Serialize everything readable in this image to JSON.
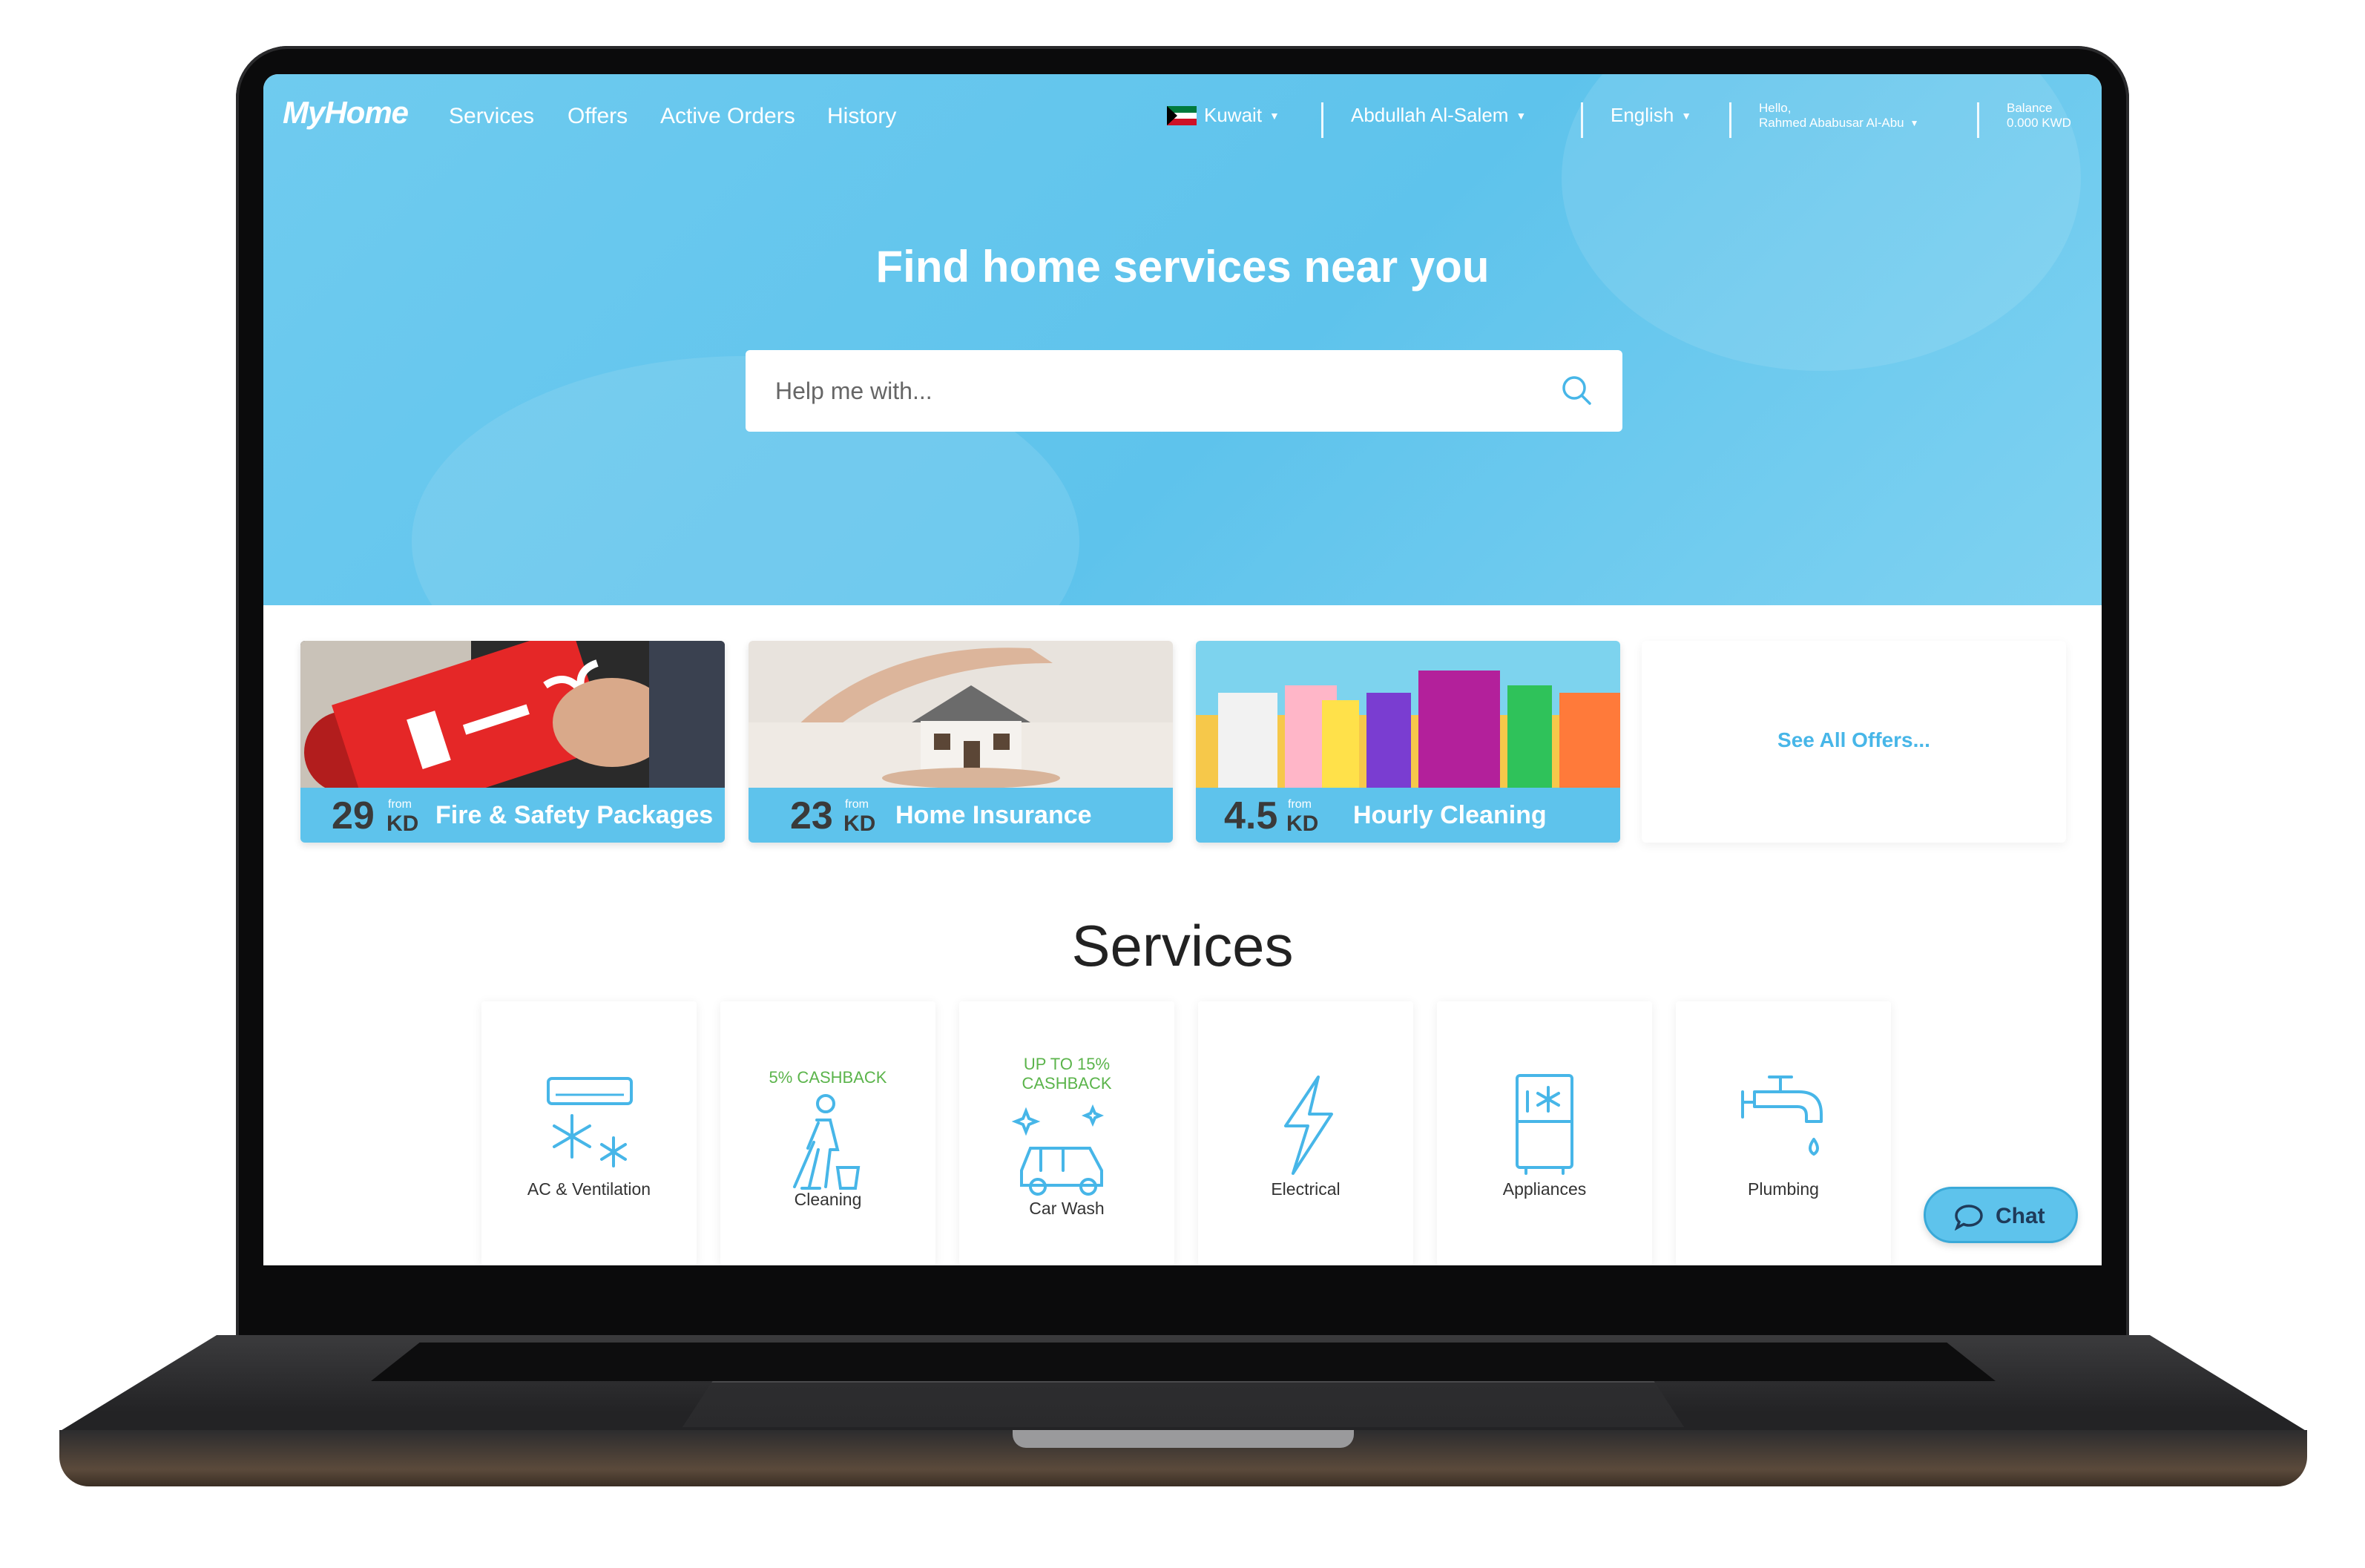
{
  "app": {
    "logo": "MyHome"
  },
  "nav": {
    "links": [
      "Services",
      "Offers",
      "Active Orders",
      "History"
    ],
    "country": "Kuwait",
    "area": "Abdullah Al-Salem",
    "language": "English",
    "greeting_line1": "Hello,",
    "greeting_line2": "Rahmed Ababusar Al-Abu",
    "balance_label": "Balance",
    "balance_value": "0.000 KWD"
  },
  "hero": {
    "title": "Find home services near you",
    "search_placeholder": "Help me with..."
  },
  "offers": [
    {
      "price": "29",
      "from": "from",
      "currency": "KD",
      "name": "Fire & Safety Packages"
    },
    {
      "price": "23",
      "from": "from",
      "currency": "KD",
      "name": "Home Insurance"
    },
    {
      "price": "4.5",
      "from": "from",
      "currency": "KD",
      "name": "Hourly Cleaning"
    }
  ],
  "see_all": "See All Offers...",
  "services_title": "Services",
  "services": [
    {
      "label": "AC & Ventilation",
      "cashback": ""
    },
    {
      "label": "Cleaning",
      "cashback": "5% CASHBACK"
    },
    {
      "label": "Car Wash",
      "cashback_line1": "UP TO 15%",
      "cashback_line2": "CASHBACK"
    },
    {
      "label": "Electrical",
      "cashback": ""
    },
    {
      "label": "Appliances",
      "cashback": ""
    },
    {
      "label": "Plumbing",
      "cashback": ""
    }
  ],
  "chat": {
    "label": "Chat"
  },
  "colors": {
    "primary": "#5ec3ec",
    "cashback": "#5bb44b",
    "icon": "#47b6e8"
  }
}
